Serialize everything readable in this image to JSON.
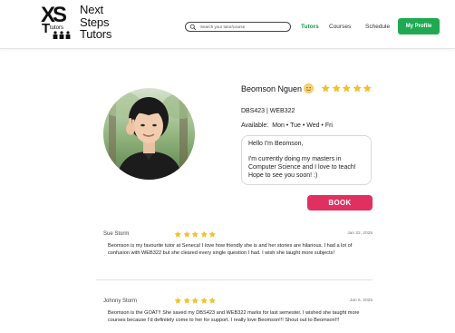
{
  "brand": {
    "mark_letters": "XS",
    "mark_sub": "Tutors",
    "line1": "Next",
    "line2": "Steps",
    "line3": "Tutors"
  },
  "search": {
    "placeholder": "Search your tutor/course"
  },
  "nav": {
    "tutors": "Tutors",
    "courses": "Courses",
    "schedule": "Schedule",
    "profile": "My Profile"
  },
  "tutor": {
    "name": "Beomson Nguen",
    "rating": 5,
    "courses": "DBS423 | WEB322",
    "available_label": "Available:",
    "available_days": "Mon • Tue • Wed • Fri",
    "bio": "Hello I'm Beomson,\n\nI'm currently doing my masters in Computer Science and I love to teach! Hope to see you soon! :)",
    "book_label": "BOOK"
  },
  "reviews": [
    {
      "name": "Sue Storm",
      "rating": 5,
      "date": "Jan 22, 2025",
      "text": "Beomson is my favourite tutor at Seneca! I love how friendly she is and her stories are hilarious. I had a lot of confusion with WEB322 but she cleared every single question I had. I wish she taught more subjects!"
    },
    {
      "name": "Johnny Storm",
      "rating": 5,
      "date": "Jan 5, 2025",
      "text": "Beomson is the GOAT!! She saved my DBS423 and WEB322 marks for last semester. I wished she taught more courses because I'd definitely come to her for support. I really love Beomson!!! Shout out to Beomson!!!"
    }
  ],
  "colors": {
    "accent_green": "#1faa52",
    "book_pink": "#e0305f",
    "star_gold": "#f2c12e"
  },
  "icons": {
    "search": "search-icon",
    "emoji": "smile-emoji-icon",
    "star": "star-icon"
  }
}
